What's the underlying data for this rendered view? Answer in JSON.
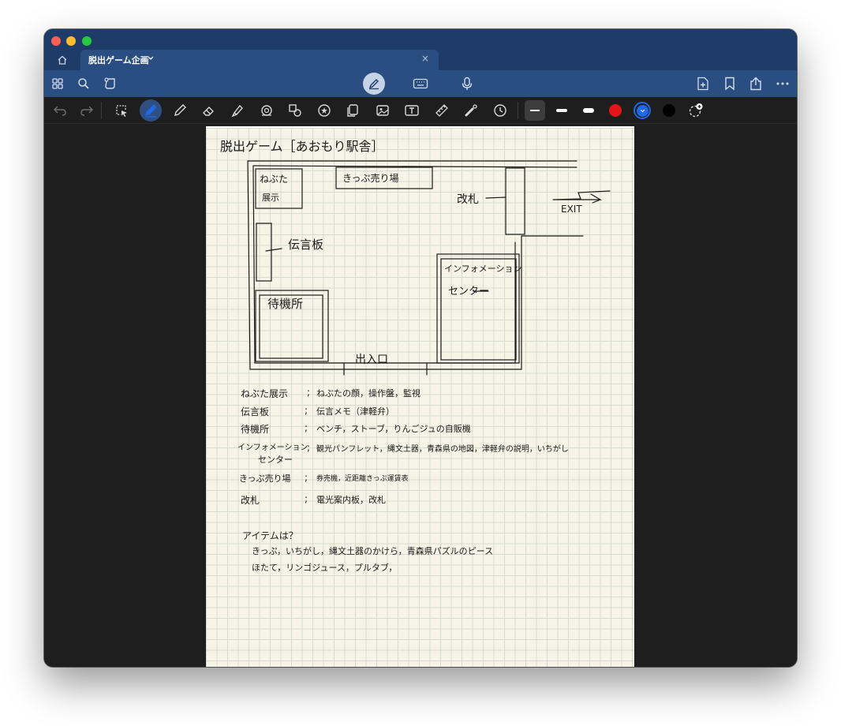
{
  "window": {
    "tab_title": "脱出ゲーム企画",
    "tab_close": "×"
  },
  "toolbar_top": {
    "left_icons": [
      "thumbnails-icon",
      "search-icon",
      "lasso-icon"
    ],
    "center_modes": [
      "pen-mode-icon",
      "keyboard-icon",
      "microphone-icon"
    ],
    "right_icons": [
      "add-page-icon",
      "bookmark-icon",
      "share-icon",
      "more-icon"
    ]
  },
  "tools": {
    "items": [
      "undo-icon",
      "redo-icon",
      "lasso-select-icon",
      "pen-icon",
      "pencil-icon",
      "eraser-icon",
      "highlighter-icon",
      "shapes-icon",
      "element-icon",
      "sticker-icon",
      "copy-icon",
      "image-icon",
      "text-icon",
      "ruler-icon",
      "laser-icon",
      "history-icon"
    ],
    "active": "pen",
    "pen_colors": [
      "#e3151b",
      "#1e69e6",
      "#000000"
    ],
    "selected_color": "#1e69e6"
  },
  "note": {
    "title": "脱出ゲーム［あおもり駅舎］",
    "map": {
      "nebuta": "ねぶた",
      "nebuta2": "展示",
      "kippu": "きっぷ売り場",
      "kaisatsu": "改札",
      "exit": "EXIT",
      "dengon": "伝言板",
      "info1": "インフォメーション",
      "info2": "センター",
      "machiai": "待機所",
      "deiriguchi": "出入口"
    },
    "legend": [
      {
        "name": "ねぶた展示",
        "sep": ";",
        "desc": "ねぶたの顔，操作盤，監視"
      },
      {
        "name": "伝言板",
        "sep": ";",
        "desc": "伝言メモ（津軽弁）"
      },
      {
        "name": "待機所",
        "sep": ";",
        "desc": "ベンチ，ストーブ，りんごジュの自販機"
      },
      {
        "name": "インフォメーション",
        "name2": "センター",
        "sep": ";",
        "desc": "観光パンフレット，縄文土器，青森県の地図，津軽弁の説明，いちがし"
      },
      {
        "name": "きっぷ売り場",
        "sep": ";",
        "desc": "券売機，近距離きっぷ運賃表"
      },
      {
        "name": "改札",
        "sep": ";",
        "desc": "電光案内板，改札"
      }
    ],
    "items_title": "アイテムは？",
    "items_line1": "きっぷ，いちがし，縄文土器のかけら，青森県パズルのピース",
    "items_line2": "ほたて，リンゴジュース，プルタブ，"
  }
}
